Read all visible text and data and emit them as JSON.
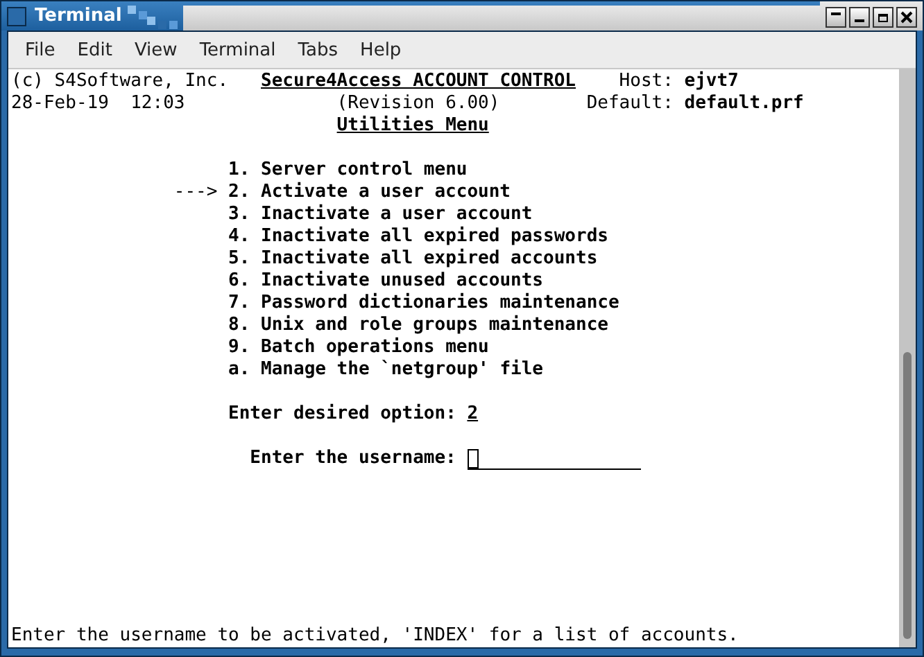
{
  "window": {
    "title": "Terminal"
  },
  "menu_bar": [
    "File",
    "Edit",
    "View",
    "Terminal",
    "Tabs",
    "Help"
  ],
  "header": {
    "company": "(c) S4Software, Inc.",
    "product": "Secure4Access ACCOUNT CONTROL",
    "host_label": "Host:",
    "host": "ejvt7",
    "date": "28-Feb-19",
    "time": "12:03",
    "revision": "(Revision 6.00)",
    "default_label": "Default:",
    "default": "default.prf",
    "menu_title": "Utilities Menu"
  },
  "pointer": "--->",
  "menu_items": [
    {
      "key": "1.",
      "label": "Server control menu",
      "selected": false
    },
    {
      "key": "2.",
      "label": "Activate a user account",
      "selected": true
    },
    {
      "key": "3.",
      "label": "Inactivate a user account",
      "selected": false
    },
    {
      "key": "4.",
      "label": "Inactivate all expired passwords",
      "selected": false
    },
    {
      "key": "5.",
      "label": "Inactivate all expired accounts",
      "selected": false
    },
    {
      "key": "6.",
      "label": "Inactivate unused accounts",
      "selected": false
    },
    {
      "key": "7.",
      "label": "Password dictionaries maintenance",
      "selected": false
    },
    {
      "key": "8.",
      "label": "Unix and role groups maintenance",
      "selected": false
    },
    {
      "key": "9.",
      "label": "Batch operations menu",
      "selected": false
    },
    {
      "key": "a.",
      "label": "Manage the `netgroup' file",
      "selected": false
    }
  ],
  "option_prompt": {
    "label": "Enter desired option:",
    "value": "2"
  },
  "username_prompt": {
    "label": "Enter the username:"
  },
  "status_line": "Enter the username to be activated, 'INDEX' for a list of accounts."
}
